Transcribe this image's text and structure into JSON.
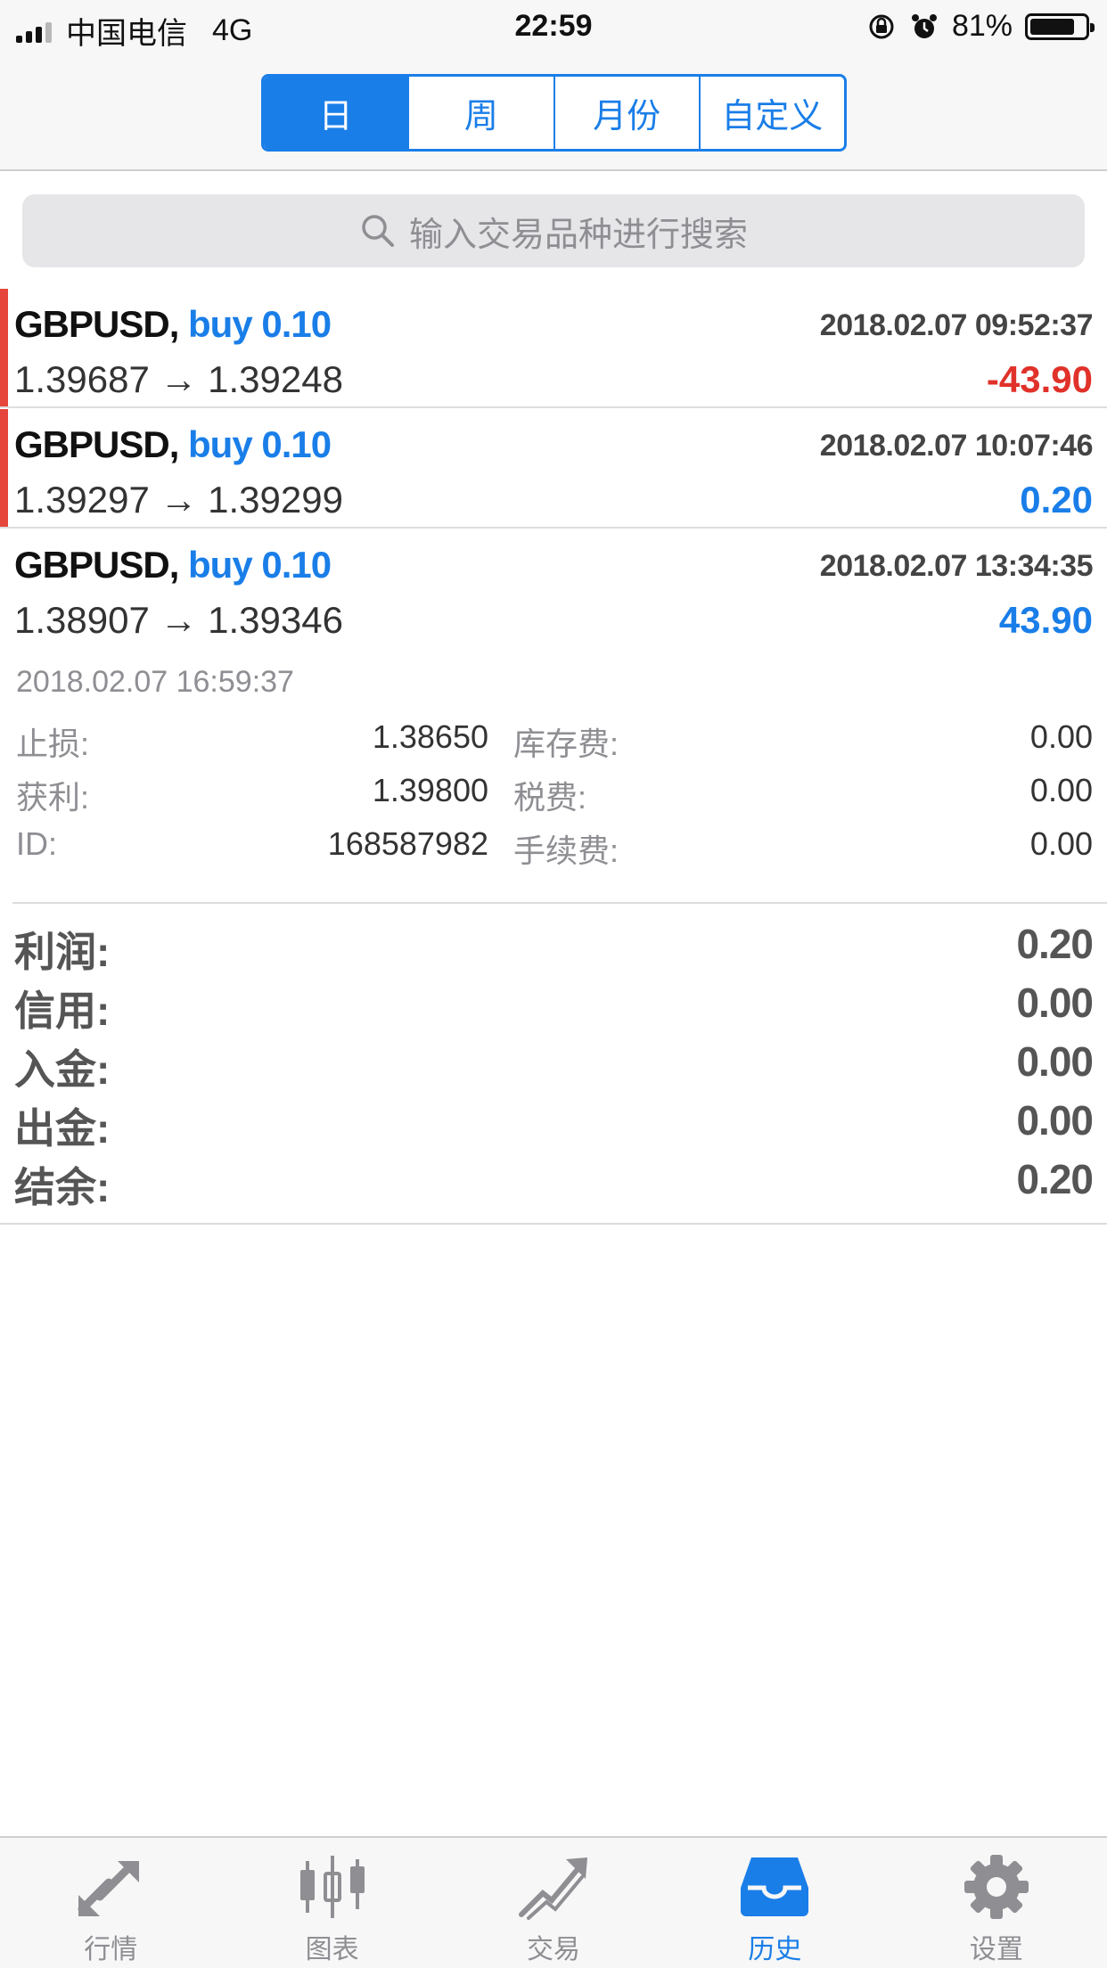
{
  "status_bar": {
    "carrier": "中国电信",
    "network": "4G",
    "time": "22:59",
    "battery": "81%"
  },
  "period_tabs": [
    {
      "label": "日",
      "active": true
    },
    {
      "label": "周",
      "active": false
    },
    {
      "label": "月份",
      "active": false
    },
    {
      "label": "自定义",
      "active": false
    }
  ],
  "search": {
    "placeholder": "输入交易品种进行搜索"
  },
  "trades": [
    {
      "symbol": "GBPUSD,",
      "direction": "buy 0.10",
      "open_time": "2018.02.07 09:52:37",
      "prices": "1.39687 → 1.39248",
      "profit": "-43.90"
    },
    {
      "symbol": "GBPUSD,",
      "direction": "buy 0.10",
      "open_time": "2018.02.07 10:07:46",
      "prices": "1.39297 → 1.39299",
      "profit": "0.20"
    },
    {
      "symbol": "GBPUSD,",
      "direction": "buy 0.10",
      "open_time": "2018.02.07 13:34:35",
      "prices": "1.38907 → 1.39346",
      "profit": "43.90"
    }
  ],
  "expanded": {
    "close_time": "2018.02.07 16:59:37",
    "rows": [
      {
        "k1": "止损:",
        "v1": "1.38650",
        "k2": "库存费:",
        "v2": "0.00"
      },
      {
        "k1": "获利:",
        "v1": "1.39800",
        "k2": "税费:",
        "v2": "0.00"
      },
      {
        "k1": "ID:",
        "v1": "168587982",
        "k2": "手续费:",
        "v2": "0.00"
      }
    ]
  },
  "summary": [
    {
      "label": "利润:",
      "value": "0.20"
    },
    {
      "label": "信用:",
      "value": "0.00"
    },
    {
      "label": "入金:",
      "value": "0.00"
    },
    {
      "label": "出金:",
      "value": "0.00"
    },
    {
      "label": "结余:",
      "value": "0.20"
    }
  ],
  "tabbar": [
    {
      "label": "行情",
      "icon": "quotes-arrows-icon",
      "active": false
    },
    {
      "label": "图表",
      "icon": "chart-candles-icon",
      "active": false
    },
    {
      "label": "交易",
      "icon": "trade-trend-icon",
      "active": false
    },
    {
      "label": "历史",
      "icon": "history-tray-icon",
      "active": true
    },
    {
      "label": "设置",
      "icon": "gear-icon",
      "active": false
    }
  ],
  "colors": {
    "accent": "#1a7ee8",
    "loss": "#e0322a",
    "loss_bar": "#e5453b"
  }
}
